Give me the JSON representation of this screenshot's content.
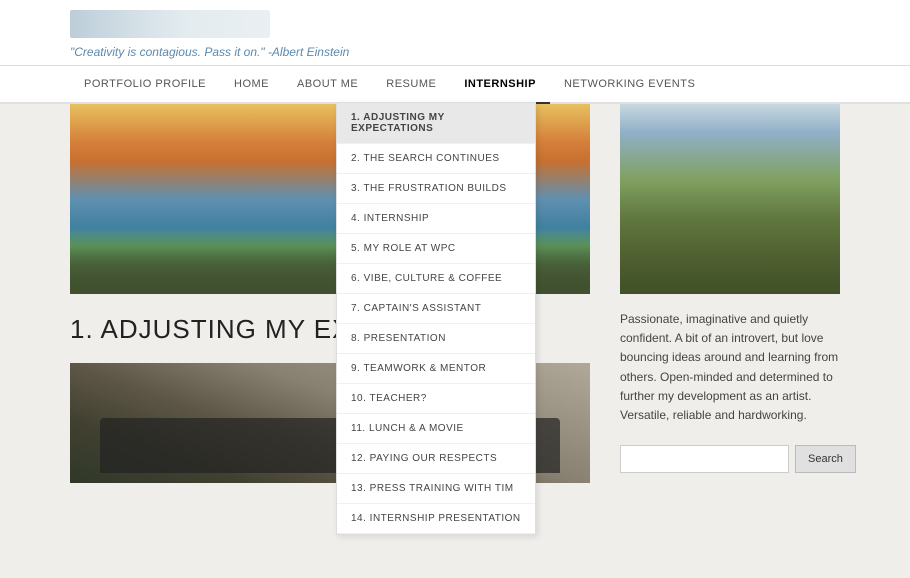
{
  "header": {
    "logo_alt": "Site Logo",
    "quote": "\"Creativity is contagious. Pass it on.\" -Albert Einstein"
  },
  "nav": {
    "items": [
      {
        "id": "portfolio",
        "label": "PORTFOLIO PROFILE",
        "active": false
      },
      {
        "id": "home",
        "label": "HOME",
        "active": false
      },
      {
        "id": "about",
        "label": "ABOUT ME",
        "active": false
      },
      {
        "id": "resume",
        "label": "RESUME",
        "active": false
      },
      {
        "id": "internship",
        "label": "INTERNSHIP",
        "active": true
      },
      {
        "id": "networking",
        "label": "NETWORKING EVENTS",
        "active": false
      }
    ]
  },
  "dropdown": {
    "items": [
      {
        "id": "item1",
        "label": "1. ADJUSTING MY EXPECTATIONS",
        "selected": true
      },
      {
        "id": "item2",
        "label": "2. THE SEARCH CONTINUES",
        "selected": false
      },
      {
        "id": "item3",
        "label": "3. THE FRUSTRATION BUILDS",
        "selected": false
      },
      {
        "id": "item4",
        "label": "4. INTERNSHIP",
        "selected": false
      },
      {
        "id": "item5",
        "label": "5. MY ROLE AT WPC",
        "selected": false
      },
      {
        "id": "item6",
        "label": "6. VIBE, CULTURE & COFFEE",
        "selected": false
      },
      {
        "id": "item7",
        "label": "7. CAPTAIN'S ASSISTANT",
        "selected": false
      },
      {
        "id": "item8",
        "label": "8. PRESENTATION",
        "selected": false
      },
      {
        "id": "item9",
        "label": "9. TEAMWORK & MENTOR",
        "selected": false
      },
      {
        "id": "item10",
        "label": "10. TEACHER?",
        "selected": false
      },
      {
        "id": "item11",
        "label": "11. LUNCH & A MOVIE",
        "selected": false
      },
      {
        "id": "item12",
        "label": "12. PAYING OUR RESPECTS",
        "selected": false
      },
      {
        "id": "item13",
        "label": "13. PRESS TRAINING WITH TIM",
        "selected": false
      },
      {
        "id": "item14",
        "label": "14. INTERNSHIP PRESENTATION",
        "selected": false
      }
    ]
  },
  "content": {
    "page_title": "1. ADJUSTING MY EXPECTATIONS",
    "bio_text": "Passionate, imaginative and quietly confident. A bit of an introvert, but love bouncing ideas around and learning from others. Open-minded and determined to further my development as an artist. Versatile, reliable and hardworking."
  },
  "search": {
    "placeholder": "",
    "button_label": "Search"
  }
}
